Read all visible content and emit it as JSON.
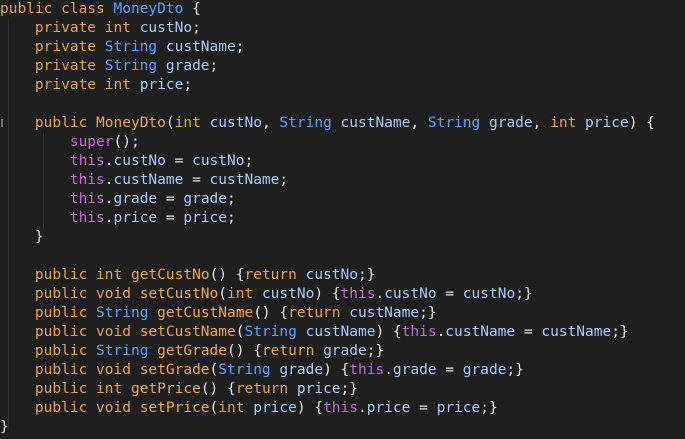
{
  "editor": {
    "language": "java",
    "lines": [
      [
        [
          "kw",
          "public"
        ],
        [
          "sp",
          " "
        ],
        [
          "kw",
          "class"
        ],
        [
          "sp",
          " "
        ],
        [
          "type",
          "MoneyDto"
        ],
        [
          "p",
          " {"
        ]
      ],
      [
        [
          "sp",
          "    "
        ],
        [
          "kw",
          "private"
        ],
        [
          "sp",
          " "
        ],
        [
          "kw",
          "int"
        ],
        [
          "sp",
          " "
        ],
        [
          "id",
          "custNo"
        ],
        [
          "p",
          ";"
        ]
      ],
      [
        [
          "sp",
          "    "
        ],
        [
          "kw",
          "private"
        ],
        [
          "sp",
          " "
        ],
        [
          "type",
          "String"
        ],
        [
          "sp",
          " "
        ],
        [
          "id",
          "custName"
        ],
        [
          "p",
          ";"
        ]
      ],
      [
        [
          "sp",
          "    "
        ],
        [
          "kw",
          "private"
        ],
        [
          "sp",
          " "
        ],
        [
          "type",
          "String"
        ],
        [
          "sp",
          " "
        ],
        [
          "id",
          "grade"
        ],
        [
          "p",
          ";"
        ]
      ],
      [
        [
          "sp",
          "    "
        ],
        [
          "kw",
          "private"
        ],
        [
          "sp",
          " "
        ],
        [
          "kw",
          "int"
        ],
        [
          "sp",
          " "
        ],
        [
          "id",
          "price"
        ],
        [
          "p",
          ";"
        ]
      ],
      [],
      [
        [
          "sp",
          "    "
        ],
        [
          "kw",
          "public"
        ],
        [
          "sp",
          " "
        ],
        [
          "m",
          "MoneyDto"
        ],
        [
          "p",
          "("
        ],
        [
          "kw",
          "int"
        ],
        [
          "sp",
          " "
        ],
        [
          "id",
          "custNo"
        ],
        [
          "p",
          ", "
        ],
        [
          "type",
          "String"
        ],
        [
          "sp",
          " "
        ],
        [
          "id",
          "custName"
        ],
        [
          "p",
          ", "
        ],
        [
          "type",
          "String"
        ],
        [
          "sp",
          " "
        ],
        [
          "id",
          "grade"
        ],
        [
          "p",
          ", "
        ],
        [
          "kw",
          "int"
        ],
        [
          "sp",
          " "
        ],
        [
          "id",
          "price"
        ],
        [
          "p",
          ") {"
        ]
      ],
      [
        [
          "sp",
          "        "
        ],
        [
          "pu",
          "super"
        ],
        [
          "p",
          "();"
        ]
      ],
      [
        [
          "sp",
          "        "
        ],
        [
          "pu",
          "this"
        ],
        [
          "p",
          "."
        ],
        [
          "id",
          "custNo"
        ],
        [
          "p",
          " = "
        ],
        [
          "id",
          "custNo"
        ],
        [
          "p",
          ";"
        ]
      ],
      [
        [
          "sp",
          "        "
        ],
        [
          "pu",
          "this"
        ],
        [
          "p",
          "."
        ],
        [
          "id",
          "custName"
        ],
        [
          "p",
          " = "
        ],
        [
          "id",
          "custName"
        ],
        [
          "p",
          ";"
        ]
      ],
      [
        [
          "sp",
          "        "
        ],
        [
          "pu",
          "this"
        ],
        [
          "p",
          "."
        ],
        [
          "id",
          "grade"
        ],
        [
          "p",
          " = "
        ],
        [
          "id",
          "grade"
        ],
        [
          "p",
          ";"
        ]
      ],
      [
        [
          "sp",
          "        "
        ],
        [
          "pu",
          "this"
        ],
        [
          "p",
          "."
        ],
        [
          "id",
          "price"
        ],
        [
          "p",
          " = "
        ],
        [
          "id",
          "price"
        ],
        [
          "p",
          ";"
        ]
      ],
      [
        [
          "sp",
          "    "
        ],
        [
          "p",
          "}"
        ]
      ],
      [],
      [
        [
          "sp",
          "    "
        ],
        [
          "kw",
          "public"
        ],
        [
          "sp",
          " "
        ],
        [
          "kw",
          "int"
        ],
        [
          "sp",
          " "
        ],
        [
          "m",
          "getCustNo"
        ],
        [
          "p",
          "() {"
        ],
        [
          "kw",
          "return"
        ],
        [
          "sp",
          " "
        ],
        [
          "id",
          "custNo"
        ],
        [
          "p",
          ";}"
        ]
      ],
      [
        [
          "sp",
          "    "
        ],
        [
          "kw",
          "public"
        ],
        [
          "sp",
          " "
        ],
        [
          "kw",
          "void"
        ],
        [
          "sp",
          " "
        ],
        [
          "m",
          "setCustNo"
        ],
        [
          "p",
          "("
        ],
        [
          "kw",
          "int"
        ],
        [
          "sp",
          " "
        ],
        [
          "id",
          "custNo"
        ],
        [
          "p",
          ") {"
        ],
        [
          "pu",
          "this"
        ],
        [
          "p",
          "."
        ],
        [
          "id",
          "custNo"
        ],
        [
          "p",
          " = "
        ],
        [
          "id",
          "custNo"
        ],
        [
          "p",
          ";}"
        ]
      ],
      [
        [
          "sp",
          "    "
        ],
        [
          "kw",
          "public"
        ],
        [
          "sp",
          " "
        ],
        [
          "type",
          "String"
        ],
        [
          "sp",
          " "
        ],
        [
          "m",
          "getCustName"
        ],
        [
          "p",
          "() {"
        ],
        [
          "kw",
          "return"
        ],
        [
          "sp",
          " "
        ],
        [
          "id",
          "custName"
        ],
        [
          "p",
          ";}"
        ]
      ],
      [
        [
          "sp",
          "    "
        ],
        [
          "kw",
          "public"
        ],
        [
          "sp",
          " "
        ],
        [
          "kw",
          "void"
        ],
        [
          "sp",
          " "
        ],
        [
          "m",
          "setCustName"
        ],
        [
          "p",
          "("
        ],
        [
          "type",
          "String"
        ],
        [
          "sp",
          " "
        ],
        [
          "id",
          "custName"
        ],
        [
          "p",
          ") {"
        ],
        [
          "pu",
          "this"
        ],
        [
          "p",
          "."
        ],
        [
          "id",
          "custName"
        ],
        [
          "p",
          " = "
        ],
        [
          "id",
          "custName"
        ],
        [
          "p",
          ";}"
        ]
      ],
      [
        [
          "sp",
          "    "
        ],
        [
          "kw",
          "public"
        ],
        [
          "sp",
          " "
        ],
        [
          "type",
          "String"
        ],
        [
          "sp",
          " "
        ],
        [
          "m",
          "getGrade"
        ],
        [
          "p",
          "() {"
        ],
        [
          "kw",
          "return"
        ],
        [
          "sp",
          " "
        ],
        [
          "id",
          "grade"
        ],
        [
          "p",
          ";}"
        ]
      ],
      [
        [
          "sp",
          "    "
        ],
        [
          "kw",
          "public"
        ],
        [
          "sp",
          " "
        ],
        [
          "kw",
          "void"
        ],
        [
          "sp",
          " "
        ],
        [
          "m",
          "setGrade"
        ],
        [
          "p",
          "("
        ],
        [
          "type",
          "String"
        ],
        [
          "sp",
          " "
        ],
        [
          "id",
          "grade"
        ],
        [
          "p",
          ") {"
        ],
        [
          "pu",
          "this"
        ],
        [
          "p",
          "."
        ],
        [
          "id",
          "grade"
        ],
        [
          "p",
          " = "
        ],
        [
          "id",
          "grade"
        ],
        [
          "p",
          ";}"
        ]
      ],
      [
        [
          "sp",
          "    "
        ],
        [
          "kw",
          "public"
        ],
        [
          "sp",
          " "
        ],
        [
          "kw",
          "int"
        ],
        [
          "sp",
          " "
        ],
        [
          "m",
          "getPrice"
        ],
        [
          "p",
          "() {"
        ],
        [
          "kw",
          "return"
        ],
        [
          "sp",
          " "
        ],
        [
          "id",
          "price"
        ],
        [
          "p",
          ";}"
        ]
      ],
      [
        [
          "sp",
          "    "
        ],
        [
          "kw",
          "public"
        ],
        [
          "sp",
          " "
        ],
        [
          "kw",
          "void"
        ],
        [
          "sp",
          " "
        ],
        [
          "m",
          "setPrice"
        ],
        [
          "p",
          "("
        ],
        [
          "kw",
          "int"
        ],
        [
          "sp",
          " "
        ],
        [
          "id",
          "price"
        ],
        [
          "p",
          ") {"
        ],
        [
          "pu",
          "this"
        ],
        [
          "p",
          "."
        ],
        [
          "id",
          "price"
        ],
        [
          "p",
          " = "
        ],
        [
          "id",
          "price"
        ],
        [
          "p",
          ";}"
        ]
      ],
      [
        [
          "p",
          "}"
        ]
      ]
    ]
  },
  "colors": {
    "background": "#1f1f1f",
    "keyword": "#e8a34a",
    "type": "#5aa0ff",
    "identifier": "#a9c9ff",
    "method": "#f0a64b",
    "special": "#c06ad8",
    "punctuation": "#e6e6e6"
  }
}
